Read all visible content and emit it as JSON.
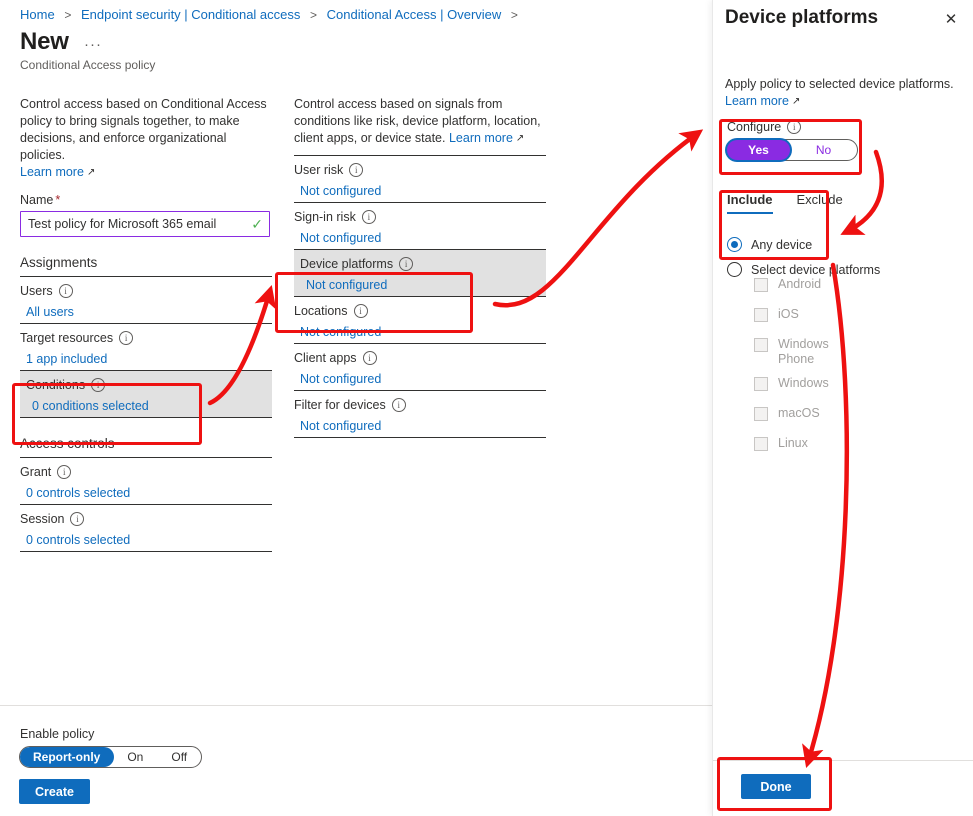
{
  "breadcrumb": {
    "items": [
      {
        "label": "Home"
      },
      {
        "label": "Endpoint security | Conditional access"
      },
      {
        "label": "Conditional Access | Overview"
      }
    ],
    "separator": ">"
  },
  "header": {
    "title": "New",
    "ellipsis": "···",
    "subtitle": "Conditional Access policy"
  },
  "left_column": {
    "blurb": "Control access based on Conditional Access policy to bring signals together, to make decisions, and enforce organizational policies.",
    "learn_more": "Learn more",
    "name_label": "Name",
    "name_required": "*",
    "name_value": "Test policy for Microsoft 365 email",
    "name_placeholder": "Name",
    "name_valid_icon": "checkmark-icon",
    "assignments_heading": "Assignments",
    "assignments": [
      {
        "label": "Users",
        "value": "All users",
        "highlighted": false
      },
      {
        "label": "Target resources",
        "value": "1 app included",
        "highlighted": false
      },
      {
        "label": "Conditions",
        "value": "0 conditions selected",
        "highlighted": true
      }
    ],
    "access_controls_heading": "Access controls",
    "access_controls": [
      {
        "label": "Grant",
        "value": "0 controls selected"
      },
      {
        "label": "Session",
        "value": "0 controls selected"
      }
    ]
  },
  "middle_column": {
    "blurb": "Control access based on signals from conditions like risk, device platform, location, client apps, or device state.",
    "learn_more": "Learn more",
    "conditions": [
      {
        "label": "User risk",
        "value": "Not configured",
        "highlighted": false
      },
      {
        "label": "Sign-in risk",
        "value": "Not configured",
        "highlighted": false
      },
      {
        "label": "Device platforms",
        "value": "Not configured",
        "highlighted": true
      },
      {
        "label": "Locations",
        "value": "Not configured",
        "highlighted": false
      },
      {
        "label": "Client apps",
        "value": "Not configured",
        "highlighted": false
      },
      {
        "label": "Filter for devices",
        "value": "Not configured",
        "highlighted": false
      }
    ]
  },
  "enable_policy": {
    "label": "Enable policy",
    "options": [
      "Report-only",
      "On",
      "Off"
    ],
    "selected": "Report-only",
    "create_button": "Create"
  },
  "panel": {
    "title": "Device platforms",
    "close_icon": "close-icon",
    "description": "Apply policy to selected device platforms.",
    "learn_more": "Learn more",
    "configure_label": "Configure",
    "configure_options": [
      "Yes",
      "No"
    ],
    "configure_selected": "Yes",
    "tabs": [
      {
        "label": "Include",
        "active": true
      },
      {
        "label": "Exclude",
        "active": false
      }
    ],
    "radios": [
      {
        "label": "Any device",
        "selected": true
      },
      {
        "label": "Select device platforms",
        "selected": false
      }
    ],
    "platforms": [
      {
        "label": "Android",
        "checked": false,
        "disabled": true
      },
      {
        "label": "iOS",
        "checked": false,
        "disabled": true
      },
      {
        "label": "Windows Phone",
        "checked": false,
        "disabled": true
      },
      {
        "label": "Windows",
        "checked": false,
        "disabled": true
      },
      {
        "label": "macOS",
        "checked": false,
        "disabled": true
      },
      {
        "label": "Linux",
        "checked": false,
        "disabled": true
      }
    ],
    "done_button": "Done"
  },
  "colors": {
    "accent_blue": "#0f6cbd",
    "annotation_red": "#ee1111",
    "purple": "#8a2be2",
    "highlight_row": "#e1e1e1",
    "valid_green": "#4caf50"
  }
}
